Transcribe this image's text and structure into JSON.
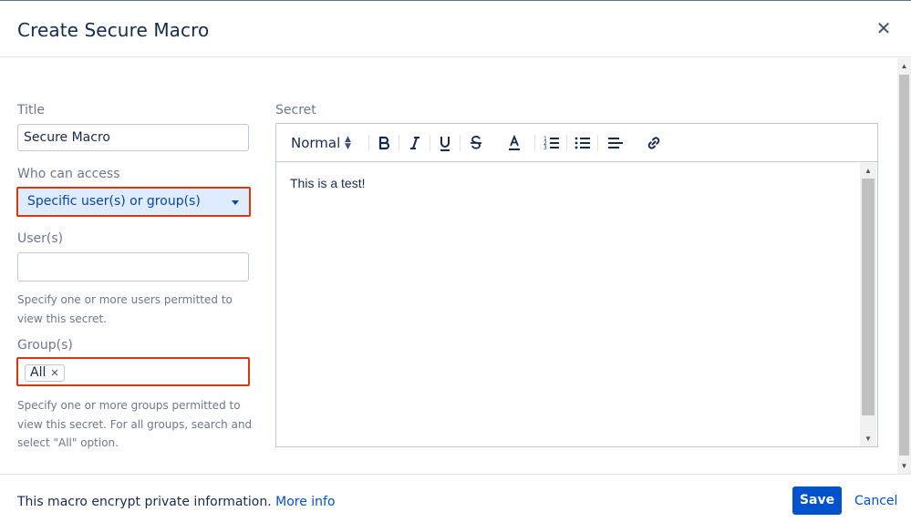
{
  "dialog": {
    "title": "Create Secure Macro",
    "close_icon": "close-icon",
    "close_glyph": "✕"
  },
  "form": {
    "title_label": "Title",
    "title_value": "Secure Macro",
    "access_label": "Who can access",
    "access_value": "Specific user(s) or group(s)",
    "users_label": "User(s)",
    "users_value": "",
    "users_help": "Specify one or more users permitted to view this secret.",
    "groups_label": "Group(s)",
    "groups_chips": [
      "All"
    ],
    "groups_help": "Specify one or more groups permitted to view this secret. For all groups, search and select \"All\" option."
  },
  "editor": {
    "label": "Secret",
    "format_value": "Normal",
    "toolbar_icons": [
      "bold-icon",
      "italic-icon",
      "underline-icon",
      "strikethrough-icon",
      "text-color-icon",
      "ordered-list-icon",
      "bullet-list-icon",
      "align-icon",
      "link-icon"
    ],
    "content": "This is a test!"
  },
  "footer": {
    "info_text": "This macro encrypt private information.",
    "more_link": "More info",
    "save_label": "Save",
    "cancel_label": "Cancel"
  },
  "colors": {
    "primary": "#0052cc",
    "error_border": "#de350b",
    "select_bg": "#dfebff",
    "text": "#172b4d",
    "muted": "#6b778c"
  }
}
